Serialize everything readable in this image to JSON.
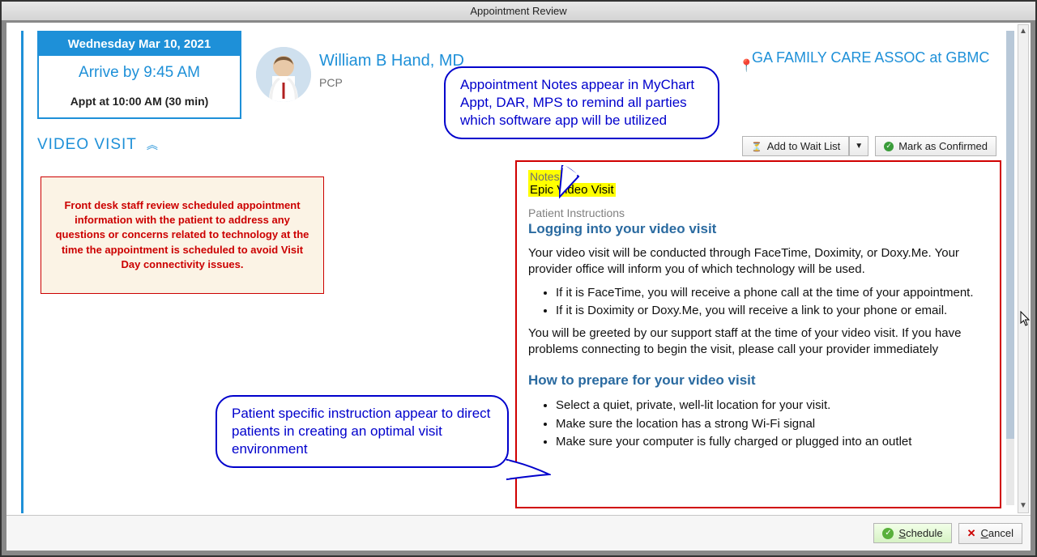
{
  "window": {
    "title": "Appointment Review"
  },
  "appointment": {
    "date_header": "Wednesday Mar 10, 2021",
    "arrive": "Arrive by 9:45 AM",
    "appt_detail": "Appt at 10:00 AM (30 min)",
    "visit_type": "VIDEO VISIT",
    "collapse_glyph": "︽"
  },
  "provider": {
    "name": "William B Hand, MD",
    "role": "PCP"
  },
  "location": {
    "name": "GA FAMILY CARE ASSOC at GBMC"
  },
  "actions": {
    "add_waitlist": "Add to Wait List",
    "mark_confirmed": "Mark as Confirmed"
  },
  "front_desk_box": "Front desk staff review scheduled appointment information with the patient to address any questions or concerns related to technology at the time the appointment is scheduled to avoid Visit Day connectivity issues.",
  "notes": {
    "label": "Notes",
    "text": "Epic Video Visit"
  },
  "instructions": {
    "section_label": "Patient Instructions",
    "heading1": "Logging into your video visit",
    "para1": "Your video visit will be conducted through FaceTime, Doximity, or Doxy.Me. Your provider office will inform you of which technology will be used.",
    "bullet1a": "If it is FaceTime, you will receive a phone call at the time of your appointment.",
    "bullet1b": "If it is Doximity or Doxy.Me, you will receive a link to your phone or email.",
    "para2": "You will be greeted by our support staff at the time of your video visit. If you have problems connecting to begin the visit, please call your provider immediately",
    "heading2": "How to prepare for your video visit",
    "bullet2a": "Select a quiet, private, well-lit location for your visit.",
    "bullet2b": "Make sure the location has a strong Wi-Fi signal",
    "bullet2c": "Make sure your computer is fully charged or plugged into an outlet"
  },
  "callouts": {
    "notes_callout": "Appointment Notes appear in MyChart Appt, DAR, MPS to remind all parties which software app will be utilized",
    "instructions_callout": "Patient specific instruction appear to direct patients in creating an optimal visit environment"
  },
  "footer": {
    "schedule_prefix": "S",
    "schedule_rest": "chedule",
    "cancel_prefix": "C",
    "cancel_rest": "ancel"
  }
}
